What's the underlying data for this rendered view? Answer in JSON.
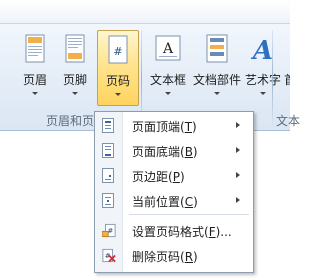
{
  "ribbon": {
    "buttons": [
      {
        "label": "页眉"
      },
      {
        "label": "页脚"
      },
      {
        "label": "页码"
      },
      {
        "label": "文本框"
      },
      {
        "label": "文档部件"
      },
      {
        "label": "艺术字"
      },
      {
        "label": "首"
      }
    ],
    "group_label": "页眉和页脚",
    "group_label_right": "文本"
  },
  "menu": {
    "items": [
      {
        "text": "页面顶端(",
        "key": "T",
        "close": ")"
      },
      {
        "text": "页面底端(",
        "key": "B",
        "close": ")"
      },
      {
        "text": "页边距(",
        "key": "P",
        "close": ")"
      },
      {
        "text": "当前位置(",
        "key": "C",
        "close": ")"
      },
      {
        "text": "设置页码格式(",
        "key": "F",
        "close": ")..."
      },
      {
        "text": "删除页码(",
        "key": "R",
        "close": ")"
      }
    ]
  },
  "colors": {
    "active_button": "#ffe48f",
    "ribbon_bg": "#e6eef8"
  }
}
